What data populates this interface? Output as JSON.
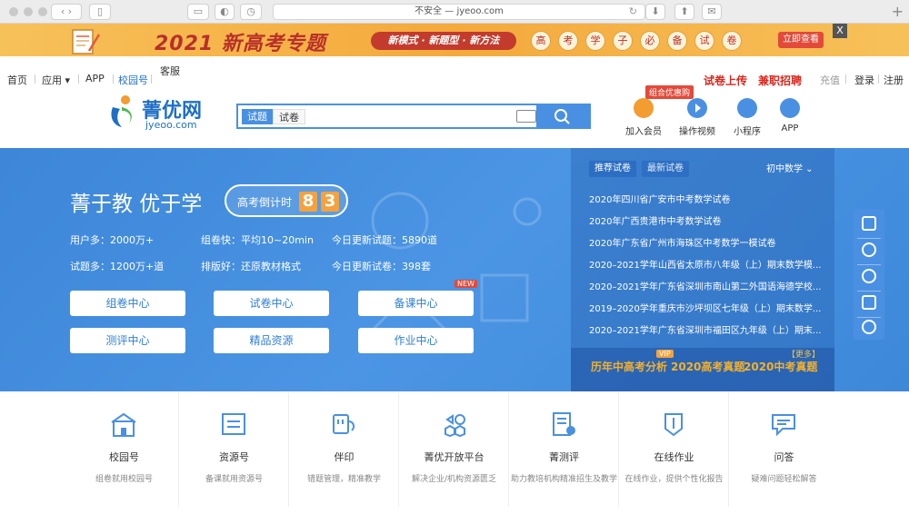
{
  "browser": {
    "address": "不安全 — jyeoo.com",
    "tab_icons": [
      "back-icon",
      "forward-icon",
      "sidebar-icon",
      "tabs-icon",
      "privacy-icon",
      "history-icon",
      "reload-icon",
      "download-icon",
      "share-icon",
      "reader-icon",
      "new-tab-icon"
    ]
  },
  "banner": {
    "title": "2021 新高考专题",
    "pill": "新模式 · 新题型 · 新方法",
    "chars": [
      "高",
      "考",
      "学",
      "子",
      "必",
      "备",
      "试",
      "卷"
    ],
    "cta": "立即查看",
    "close": "X"
  },
  "topnav": {
    "left": [
      "首页",
      "应用",
      "APP",
      "校园号",
      "客服"
    ],
    "right_red": [
      "试卷上传",
      "兼职招聘"
    ],
    "right_gray": "充值",
    "login": "登录",
    "register": "注册"
  },
  "header": {
    "logo_text": "菁优网",
    "logo_sub": "jyeoo.com",
    "search_tabs": [
      "试题",
      "试卷"
    ],
    "search_placeholder": "",
    "promo": "组合优惠购",
    "icons": [
      {
        "name": "join-vip-icon",
        "label": "加入会员",
        "color": "#f39c2f"
      },
      {
        "name": "video-icon",
        "label": "操作视频",
        "color": "#4a90e2"
      },
      {
        "name": "mini-program-icon",
        "label": "小程序",
        "color": "#4a90e2"
      },
      {
        "name": "app-icon",
        "label": "APP",
        "color": "#4a90e2"
      }
    ]
  },
  "hero": {
    "slogan": "菁于教 优于学",
    "countdown_label": "高考倒计时",
    "countdown_digits": [
      "8",
      "3"
    ],
    "stats": [
      "用户多：2000万+",
      "组卷快：平均10~20min",
      "今日更新试题：5890道",
      "试题多：1200万+道",
      "排版好：还原教材格式",
      "今日更新试卷：398套"
    ],
    "buttons": [
      "组卷中心",
      "试卷中心",
      "备课中心",
      "测评中心",
      "精品资源",
      "作业中心"
    ],
    "new_tag": "NEW"
  },
  "panel": {
    "tabs": [
      "推荐试卷",
      "最新试卷"
    ],
    "subject": "初中数学 ⌄",
    "items": [
      "2020年四川省广安市中考数学试卷",
      "2020年广西贵港市中考数学试卷",
      "2020年广东省广州市海珠区中考数学一模试卷",
      "2020–2021学年山西省太原市八年级（上）期末数学模...",
      "2020–2021学年广东省深圳市南山第二外国语海德学校...",
      "2019–2020学年重庆市沙坪坝区七年级（上）期末数学...",
      "2020–2021学年广东省深圳市福田区九年级（上）期末..."
    ],
    "more": "【更多】",
    "bottom_links": [
      "历年中高考分析",
      "2020高考真题",
      "2020中考真题"
    ],
    "vip": "VIP"
  },
  "features": [
    {
      "icon": "campus-icon",
      "title": "校园号",
      "desc": "组卷就用校园号"
    },
    {
      "icon": "resource-icon",
      "title": "资源号",
      "desc": "备课就用资源号"
    },
    {
      "icon": "printer-icon",
      "title": "伴印",
      "desc": "错题管理，精准教学"
    },
    {
      "icon": "platform-icon",
      "title": "菁优开放平台",
      "desc": "解决企业/机构资源匮乏"
    },
    {
      "icon": "assessment-icon",
      "title": "菁测评",
      "desc": "助力教培机构精准招生及教学"
    },
    {
      "icon": "homework-icon",
      "title": "在线作业",
      "desc": "在线作业，提供个性化报告"
    },
    {
      "icon": "qa-icon",
      "title": "问答",
      "desc": "疑难问题轻松解答"
    }
  ]
}
